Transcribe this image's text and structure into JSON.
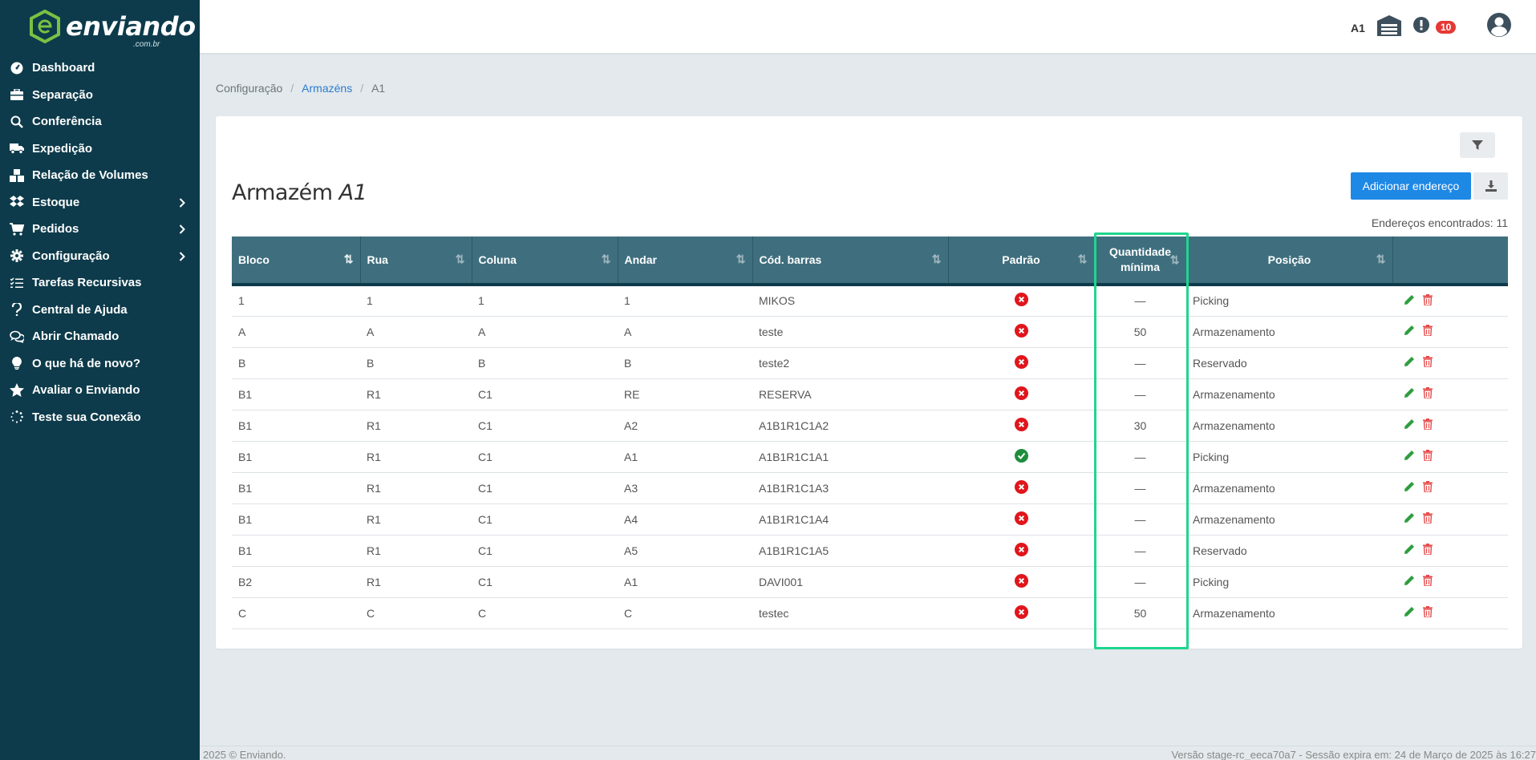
{
  "brand": {
    "name": "enviando",
    "sub": ".com.br"
  },
  "sidebar": {
    "items": [
      {
        "label": "Dashboard",
        "icon": "gauge-icon",
        "chevron": false
      },
      {
        "label": "Separação",
        "icon": "briefcase-icon",
        "chevron": false
      },
      {
        "label": "Conferência",
        "icon": "search-icon",
        "chevron": false
      },
      {
        "label": "Expedição",
        "icon": "truck-icon",
        "chevron": false
      },
      {
        "label": "Relação de Volumes",
        "icon": "boxes-icon",
        "chevron": false
      },
      {
        "label": "Estoque",
        "icon": "dropbox-icon",
        "chevron": true
      },
      {
        "label": "Pedidos",
        "icon": "cart-icon",
        "chevron": true
      },
      {
        "label": "Configuração",
        "icon": "gear-icon",
        "chevron": true
      },
      {
        "label": "Tarefas Recursivas",
        "icon": "tasks-icon",
        "chevron": false
      },
      {
        "label": "Central de Ajuda",
        "icon": "question-icon",
        "chevron": false
      },
      {
        "label": "Abrir Chamado",
        "icon": "chat-icon",
        "chevron": false
      },
      {
        "label": "O que há de novo?",
        "icon": "bulb-icon",
        "chevron": false
      },
      {
        "label": "Avaliar o Enviando",
        "icon": "star-icon",
        "chevron": false
      },
      {
        "label": "Teste sua Conexão",
        "icon": "spinner-icon",
        "chevron": false
      }
    ]
  },
  "topbar": {
    "warehouse_label": "A1",
    "alert_count": "10"
  },
  "breadcrumb": {
    "root": "Configuração",
    "link": "Armazéns",
    "current": "A1",
    "separator": "/"
  },
  "page": {
    "title_prefix": "Armazém",
    "title_name": "A1",
    "add_button": "Adicionar endereço",
    "found_text": "Endereços encontrados: 11"
  },
  "table": {
    "headers": {
      "bloco": "Bloco",
      "rua": "Rua",
      "coluna": "Coluna",
      "andar": "Andar",
      "cod": "Cód. barras",
      "padrao": "Padrão",
      "qtd1": "Quantidade",
      "qtd2": "mínima",
      "posicao": "Posição"
    },
    "rows": [
      {
        "bloco": "1",
        "rua": "1",
        "coluna": "1",
        "andar": "1",
        "cod": "MIKOS",
        "padrao": false,
        "qtd": "—",
        "posicao": "Picking"
      },
      {
        "bloco": "A",
        "rua": "A",
        "coluna": "A",
        "andar": "A",
        "cod": "teste",
        "padrao": false,
        "qtd": "50",
        "posicao": "Armazenamento"
      },
      {
        "bloco": "B",
        "rua": "B",
        "coluna": "B",
        "andar": "B",
        "cod": "teste2",
        "padrao": false,
        "qtd": "—",
        "posicao": "Reservado"
      },
      {
        "bloco": "B1",
        "rua": "R1",
        "coluna": "C1",
        "andar": "RE",
        "cod": "RESERVA",
        "padrao": false,
        "qtd": "—",
        "posicao": "Armazenamento"
      },
      {
        "bloco": "B1",
        "rua": "R1",
        "coluna": "C1",
        "andar": "A2",
        "cod": "A1B1R1C1A2",
        "padrao": false,
        "qtd": "30",
        "posicao": "Armazenamento"
      },
      {
        "bloco": "B1",
        "rua": "R1",
        "coluna": "C1",
        "andar": "A1",
        "cod": "A1B1R1C1A1",
        "padrao": true,
        "qtd": "—",
        "posicao": "Picking"
      },
      {
        "bloco": "B1",
        "rua": "R1",
        "coluna": "C1",
        "andar": "A3",
        "cod": "A1B1R1C1A3",
        "padrao": false,
        "qtd": "—",
        "posicao": "Armazenamento"
      },
      {
        "bloco": "B1",
        "rua": "R1",
        "coluna": "C1",
        "andar": "A4",
        "cod": "A1B1R1C1A4",
        "padrao": false,
        "qtd": "—",
        "posicao": "Armazenamento"
      },
      {
        "bloco": "B1",
        "rua": "R1",
        "coluna": "C1",
        "andar": "A5",
        "cod": "A1B1R1C1A5",
        "padrao": false,
        "qtd": "—",
        "posicao": "Reservado"
      },
      {
        "bloco": "B2",
        "rua": "R1",
        "coluna": "C1",
        "andar": "A1",
        "cod": "DAVI001",
        "padrao": false,
        "qtd": "—",
        "posicao": "Picking"
      },
      {
        "bloco": "C",
        "rua": "C",
        "coluna": "C",
        "andar": "C",
        "cod": "testec",
        "padrao": false,
        "qtd": "50",
        "posicao": "Armazenamento"
      }
    ]
  },
  "footer": {
    "left": "2025 © Enviando.",
    "right": "Versão stage-rc_eeca70a7 - Sessão expira em: 24 de Março de 2025 às 16:27"
  },
  "colors": {
    "sidebar": "#0d3b4b",
    "header": "#3f6f7e",
    "primary": "#1e88e5",
    "highlight": "#1ed68e",
    "danger": "#e0161c",
    "success": "#1e8e3e"
  }
}
